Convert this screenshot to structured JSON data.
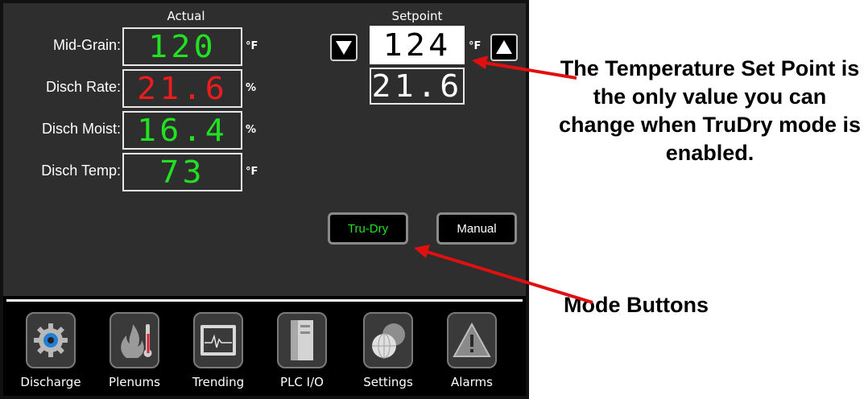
{
  "headers": {
    "actual": "Actual",
    "setpoint": "Setpoint"
  },
  "rows": [
    {
      "label": "Mid-Grain:",
      "value": "120",
      "unit": "°F",
      "color": "#22e022"
    },
    {
      "label": "Disch Rate:",
      "value": "21.6",
      "unit": "%",
      "color": "#ee1c1c"
    },
    {
      "label": "Disch Moist:",
      "value": "16.4",
      "unit": "%",
      "color": "#22e022"
    },
    {
      "label": "Disch Temp:",
      "value": "73",
      "unit": "°F",
      "color": "#22e022"
    }
  ],
  "setpoint": {
    "temp_value": "124",
    "temp_unit": "°F",
    "rate_value": "21.6"
  },
  "modes": {
    "trudry_label": "Tru-Dry",
    "manual_label": "Manual"
  },
  "nav": [
    {
      "label": "Discharge",
      "icon": "gear-icon"
    },
    {
      "label": "Plenums",
      "icon": "flame-thermometer-icon"
    },
    {
      "label": "Trending",
      "icon": "trend-monitor-icon"
    },
    {
      "label": "PLC I/O",
      "icon": "plc-cabinet-icon"
    },
    {
      "label": "Settings",
      "icon": "settings-globe-icon"
    },
    {
      "label": "Alarms",
      "icon": "warning-triangle-icon"
    }
  ],
  "callouts": {
    "setpoint_note": "The Temperature Set Point is the only value you can change when TruDry mode is enabled.",
    "mode_note": "Mode Buttons"
  },
  "colors": {
    "accent_green": "#22e022",
    "alarm_red": "#ee1c1c",
    "callout_arrow": "#e01010"
  }
}
